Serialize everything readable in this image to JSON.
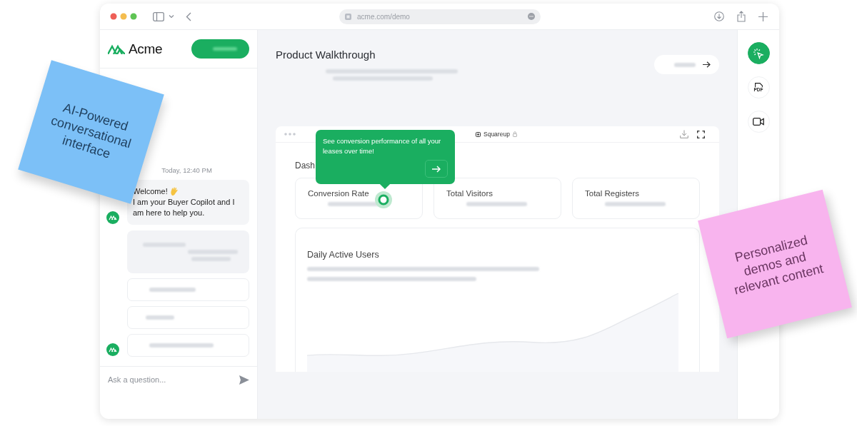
{
  "browser": {
    "url": "acme.com/demo"
  },
  "sidebar": {
    "logo": "Acme",
    "timestamp": "Today, 12:40 PM",
    "welcome": {
      "greeting": "Welcome!",
      "text": "I am your Buyer Copilot and I am here to help you."
    },
    "input": {
      "placeholder": "Ask a question..."
    }
  },
  "main": {
    "title": "Product Walkthrough",
    "embed": {
      "site": "Squareup",
      "heading": "Dash",
      "stats": [
        {
          "label": "Conversion Rate"
        },
        {
          "label": "Total Visitors"
        },
        {
          "label": "Total Registers"
        }
      ],
      "chart": {
        "title": "Daily Active Users"
      },
      "tooltip": {
        "text": "See conversion performance of all your leases over time!"
      }
    }
  },
  "rail": {
    "items": [
      {
        "kind": "cursor",
        "selected": true
      },
      {
        "kind": "pdf",
        "label": "PDF",
        "selected": false
      },
      {
        "kind": "video",
        "selected": false
      }
    ]
  },
  "notes": [
    {
      "text": "AI-Powered conversational interface",
      "color": "#7cc0f7"
    },
    {
      "text": "Personalized demos and relevant content",
      "color": "#f8b4ee"
    }
  ]
}
